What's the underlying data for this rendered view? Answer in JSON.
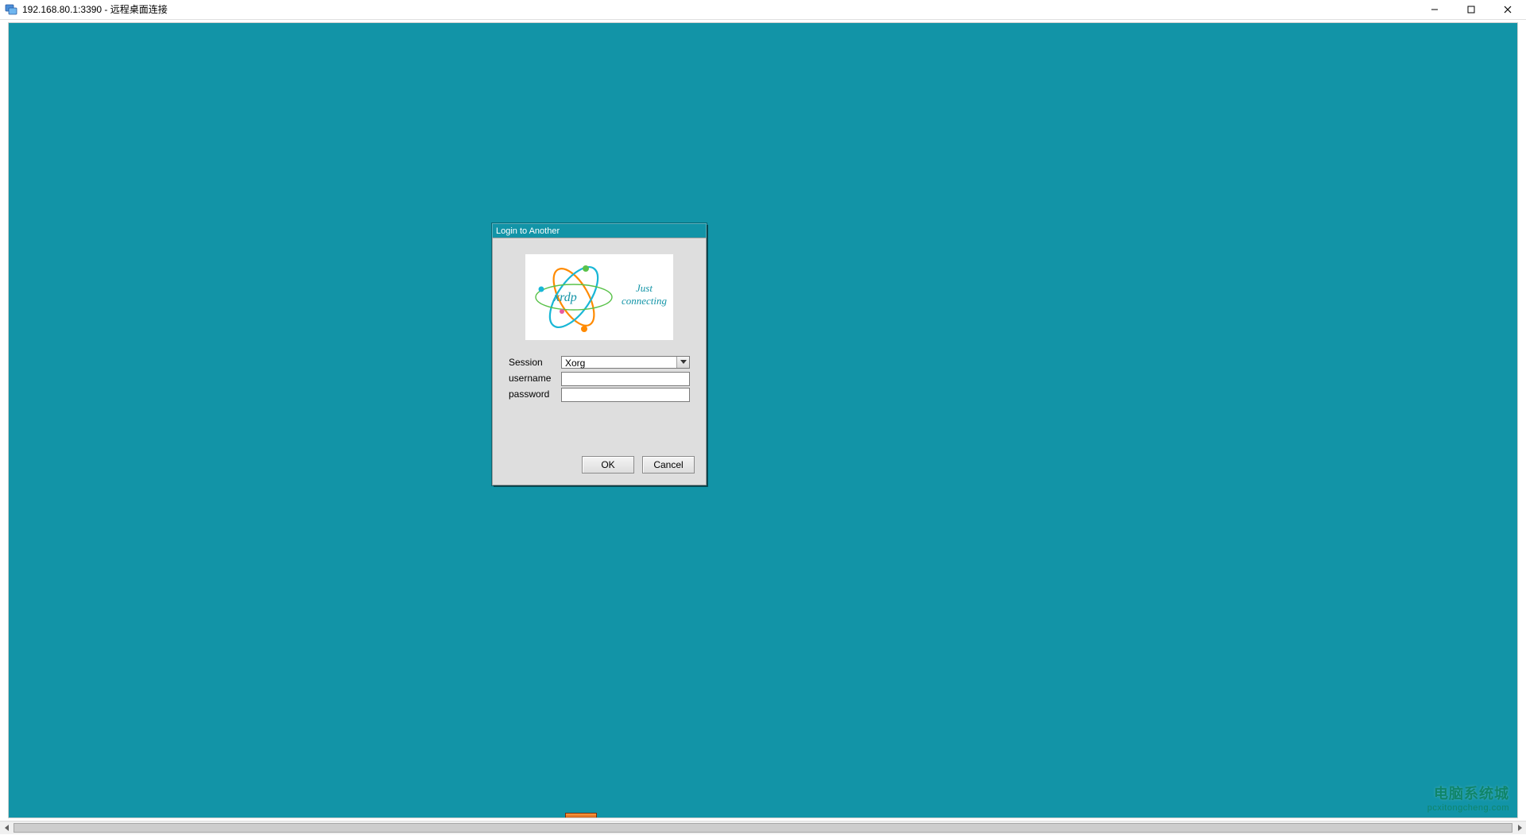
{
  "window": {
    "title": "192.168.80.1:3390 - 远程桌面连接"
  },
  "login_dialog": {
    "title": "Login to Another",
    "logo_text": "xrdp",
    "tagline_line1": "Just",
    "tagline_line2": "connecting",
    "labels": {
      "session": "Session",
      "username": "username",
      "password": "password"
    },
    "fields": {
      "session_value": "Xorg",
      "username_value": "",
      "password_value": ""
    },
    "buttons": {
      "ok": "OK",
      "cancel": "Cancel"
    }
  },
  "watermark": {
    "line1": "电脑系统城",
    "line2": "pcxitongcheng.com"
  }
}
